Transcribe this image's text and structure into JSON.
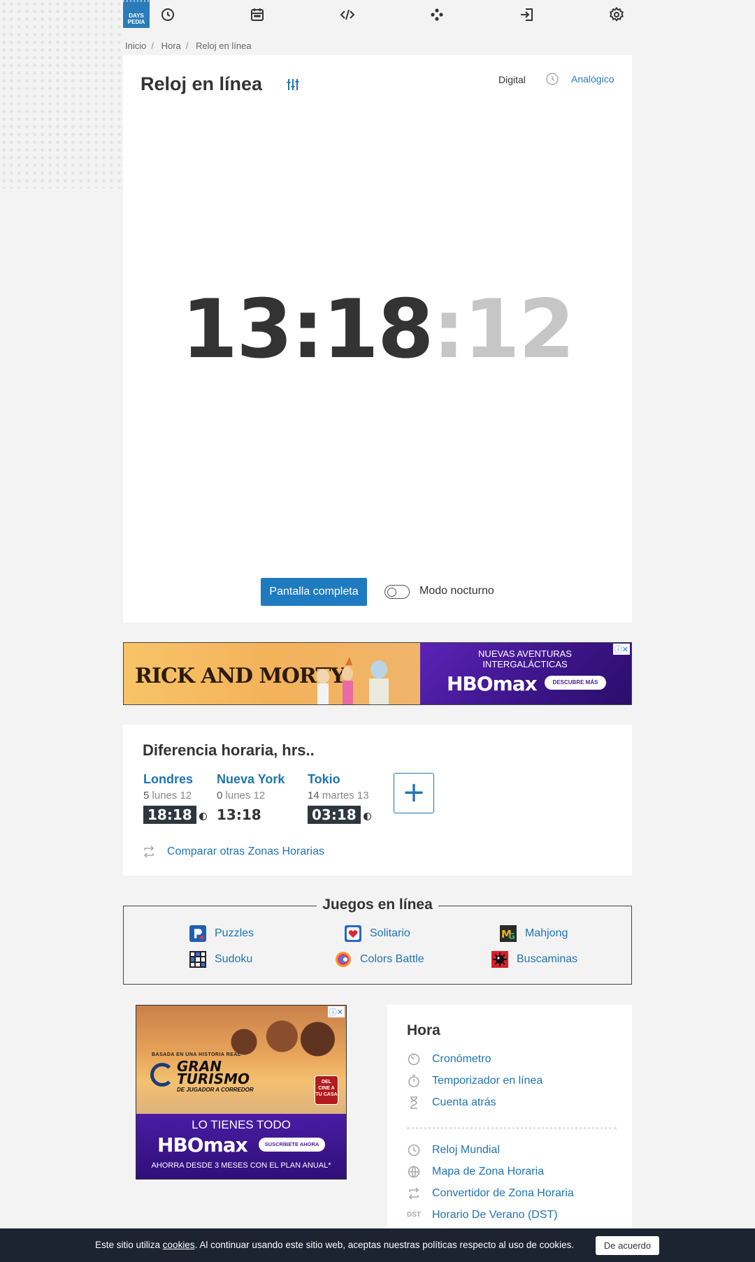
{
  "logo": {
    "line1": "DAYS",
    "line2": "PEDIA"
  },
  "nav": {
    "icons": [
      "clock-icon",
      "calendar-icon",
      "code-icon",
      "games-icon",
      "login-icon",
      "gear-icon"
    ]
  },
  "breadcrumb": [
    "Inicio",
    "Hora",
    "Reloj en línea"
  ],
  "clock_panel": {
    "title": "Reloj en línea",
    "mode_digital": "Digital",
    "mode_analog": "Analógico",
    "time_hm": "13:18",
    "time_sec": ":12",
    "fullscreen_label": "Pantalla completa",
    "night_mode_label": "Modo nocturno"
  },
  "ad1": {
    "left_title": "RICK AND MORTY",
    "tagline_1": "NUEVAS AVENTURAS",
    "tagline_2": "INTERGALÁCTICAS",
    "brand": "HBOmax",
    "cta": "DESCUBRE MÁS"
  },
  "time_difference": {
    "title": "Diferencia horaria, hrs..",
    "cities": [
      {
        "name": "Londres",
        "offset": "5",
        "day": "lunes 12",
        "time": "18:18",
        "night": true
      },
      {
        "name": "Nueva York",
        "offset": "0",
        "day": "lunes 12",
        "time": "13:18",
        "night": false
      },
      {
        "name": "Tokio",
        "offset": "14",
        "day": "martes 13",
        "time": "03:18",
        "night": true
      }
    ],
    "add_label": "+",
    "compare_link": "Comparar otras Zonas Horarias"
  },
  "games": {
    "title": "Juegos en línea",
    "items": [
      "Puzzles",
      "Solitario",
      "Mahjong",
      "Sudoku",
      "Colors Battle",
      "Buscaminas"
    ]
  },
  "ad2": {
    "based": "BASADA EN UNA HISTORIA REAL",
    "gt_1": "GRAN",
    "gt_2": "TURISMO",
    "gt_sub": "DE JUGADOR A CORREDOR",
    "badge": "DEL CINE A TU CASA",
    "line1": "LO TIENES TODO",
    "brand": "HBOmax",
    "cta": "SUSCRÍBETE AHORA",
    "line3": "AHORRA DESDE 3 MESES CON EL PLAN ANUAL*"
  },
  "side_nav": {
    "title": "Hora",
    "group1": [
      "Cronómetro",
      "Temporizador en línea",
      "Cuenta atrás"
    ],
    "group2": [
      "Reloj Mundial",
      "Mapa de Zona Horaria",
      "Convertidor de Zona Horaria",
      "Horario De Verano (DST)"
    ],
    "dst_abbr": "DST"
  },
  "cookie": {
    "text_before": "Este sitio utiliza ",
    "link": "cookies",
    "text_after": ". Al continuar usando este sitio web, aceptas nuestras políticas respecto al uso de cookies.",
    "button": "De acuerdo"
  }
}
